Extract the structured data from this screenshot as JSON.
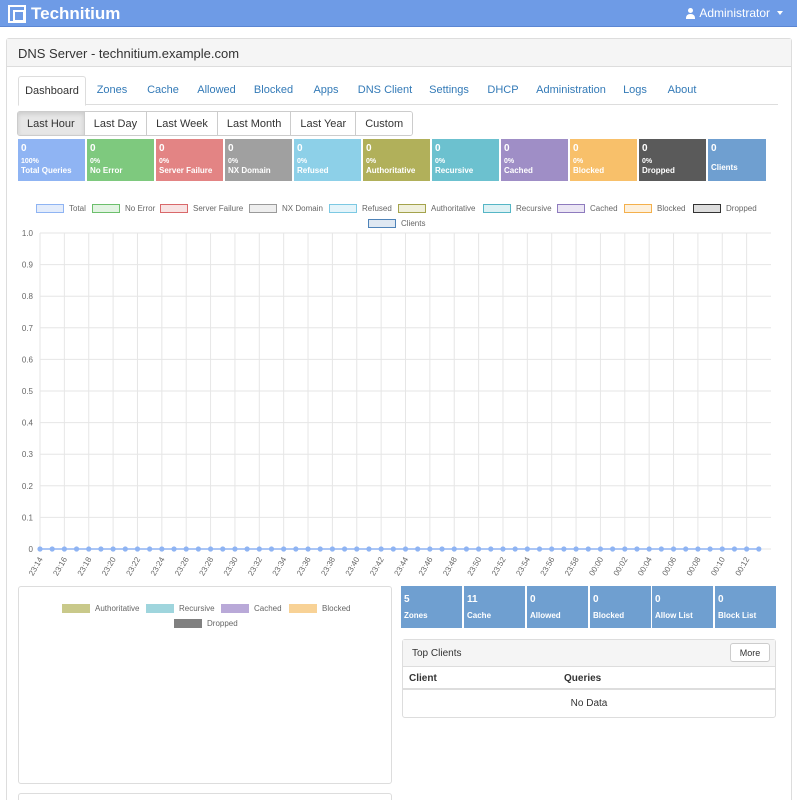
{
  "navbar": {
    "brand": "Technitium",
    "user": "Administrator",
    "bg_color": "#6e9be6"
  },
  "panel": {
    "title": "DNS Server - technitium.example.com"
  },
  "tabs": [
    "Dashboard",
    "Zones",
    "Cache",
    "Allowed",
    "Blocked",
    "Apps",
    "DNS Client",
    "Settings",
    "DHCP",
    "Administration",
    "Logs",
    "About"
  ],
  "active_tab": "Dashboard",
  "ranges": [
    "Last Hour",
    "Last Day",
    "Last Week",
    "Last Month",
    "Last Year",
    "Custom"
  ],
  "active_range": "Last Hour",
  "stats": [
    {
      "value": "0",
      "percent": "100%",
      "label": "Total Queries",
      "color": "#8fb4f3"
    },
    {
      "value": "0",
      "percent": "0%",
      "label": "No Error",
      "color": "#7ec97e"
    },
    {
      "value": "0",
      "percent": "0%",
      "label": "Server Failure",
      "color": "#e38484"
    },
    {
      "value": "0",
      "percent": "0%",
      "label": "NX Domain",
      "color": "#a0a0a0"
    },
    {
      "value": "0",
      "percent": "0%",
      "label": "Refused",
      "color": "#8dd0e8"
    },
    {
      "value": "0",
      "percent": "0%",
      "label": "Authoritative",
      "color": "#b1b05a"
    },
    {
      "value": "0",
      "percent": "0%",
      "label": "Recursive",
      "color": "#6cc1cf"
    },
    {
      "value": "0",
      "percent": "0%",
      "label": "Cached",
      "color": "#9f8ec6"
    },
    {
      "value": "0",
      "percent": "0%",
      "label": "Blocked",
      "color": "#f8c06a"
    },
    {
      "value": "0",
      "percent": "0%",
      "label": "Dropped",
      "color": "#5a5a5a"
    },
    {
      "value": "0",
      "percent": "",
      "label": "Clients",
      "color": "#6f9fd0"
    }
  ],
  "legend": [
    {
      "label": "Total",
      "color": "#8fb4f3",
      "fill": "#e3ecfb"
    },
    {
      "label": "No Error",
      "color": "#6cbf6c",
      "fill": "#e2f3e2"
    },
    {
      "label": "Server Failure",
      "color": "#d9686a",
      "fill": "#f8e3e3"
    },
    {
      "label": "NX Domain",
      "color": "#9a9a9a",
      "fill": "#eeeeee"
    },
    {
      "label": "Refused",
      "color": "#7cc9e3",
      "fill": "#e4f4fa"
    },
    {
      "label": "Authoritative",
      "color": "#a4a34c",
      "fill": "#f0f0dc"
    },
    {
      "label": "Recursive",
      "color": "#55b6c6",
      "fill": "#ddf1f4"
    },
    {
      "label": "Cached",
      "color": "#8e7bbe",
      "fill": "#ebe6f4"
    },
    {
      "label": "Blocked",
      "color": "#f4b04c",
      "fill": "#fdf0dc"
    },
    {
      "label": "Dropped",
      "color": "#333333",
      "fill": "#dddddd"
    },
    {
      "label": "Clients",
      "color": "#4f83b8",
      "fill": "#dfe8f2"
    }
  ],
  "chart_data": {
    "type": "line",
    "x": [
      "23:14",
      "23:15",
      "23:16",
      "23:17",
      "23:18",
      "23:19",
      "23:20",
      "23:21",
      "23:22",
      "23:23",
      "23:24",
      "23:25",
      "23:26",
      "23:27",
      "23:28",
      "23:29",
      "23:30",
      "23:31",
      "23:32",
      "23:33",
      "23:34",
      "23:35",
      "23:36",
      "23:37",
      "23:38",
      "23:39",
      "23:40",
      "23:41",
      "23:42",
      "23:43",
      "23:44",
      "23:45",
      "23:46",
      "23:47",
      "23:48",
      "23:49",
      "23:50",
      "23:51",
      "23:52",
      "23:53",
      "23:54",
      "23:55",
      "23:56",
      "23:57",
      "23:58",
      "23:59",
      "00:00",
      "00:01",
      "00:02",
      "00:03",
      "00:04",
      "00:05",
      "00:06",
      "00:07",
      "00:08",
      "00:09",
      "00:10",
      "00:11",
      "00:12",
      "00:13"
    ],
    "x_tick_labels": [
      "23:14",
      "23:16",
      "23:18",
      "23:20",
      "23:22",
      "23:24",
      "23:26",
      "23:28",
      "23:30",
      "23:32",
      "23:34",
      "23:36",
      "23:38",
      "23:40",
      "23:42",
      "23:44",
      "23:46",
      "23:48",
      "23:50",
      "23:52",
      "23:54",
      "23:56",
      "23:58",
      "00:00",
      "00:02",
      "00:04",
      "00:06",
      "00:08",
      "00:10",
      "00:12"
    ],
    "y_ticks": [
      "1.0",
      "0.9",
      "0.8",
      "0.7",
      "0.6",
      "0.5",
      "0.4",
      "0.3",
      "0.2",
      "0.1",
      "0"
    ],
    "ylim": [
      0,
      1
    ],
    "grid": true,
    "series": [
      {
        "name": "Total",
        "values_all": 0
      }
    ]
  },
  "pie_legend": [
    {
      "label": "Authoritative",
      "color": "#c9c98a"
    },
    {
      "label": "Recursive",
      "color": "#9fd5dd"
    },
    {
      "label": "Cached",
      "color": "#b9a9d8"
    },
    {
      "label": "Blocked",
      "color": "#f8d296"
    },
    {
      "label": "Dropped",
      "color": "#808080"
    }
  ],
  "stats2": [
    {
      "value": "5",
      "label": "Zones"
    },
    {
      "value": "11",
      "label": "Cache"
    },
    {
      "value": "0",
      "label": "Allowed"
    },
    {
      "value": "0",
      "label": "Blocked"
    },
    {
      "value": "0",
      "label": "Allow List"
    },
    {
      "value": "0",
      "label": "Block List"
    }
  ],
  "stats2_color": "#6f9fd0",
  "top_clients": {
    "title": "Top Clients",
    "more": "More",
    "col_client": "Client",
    "col_queries": "Queries",
    "empty": "No Data"
  }
}
